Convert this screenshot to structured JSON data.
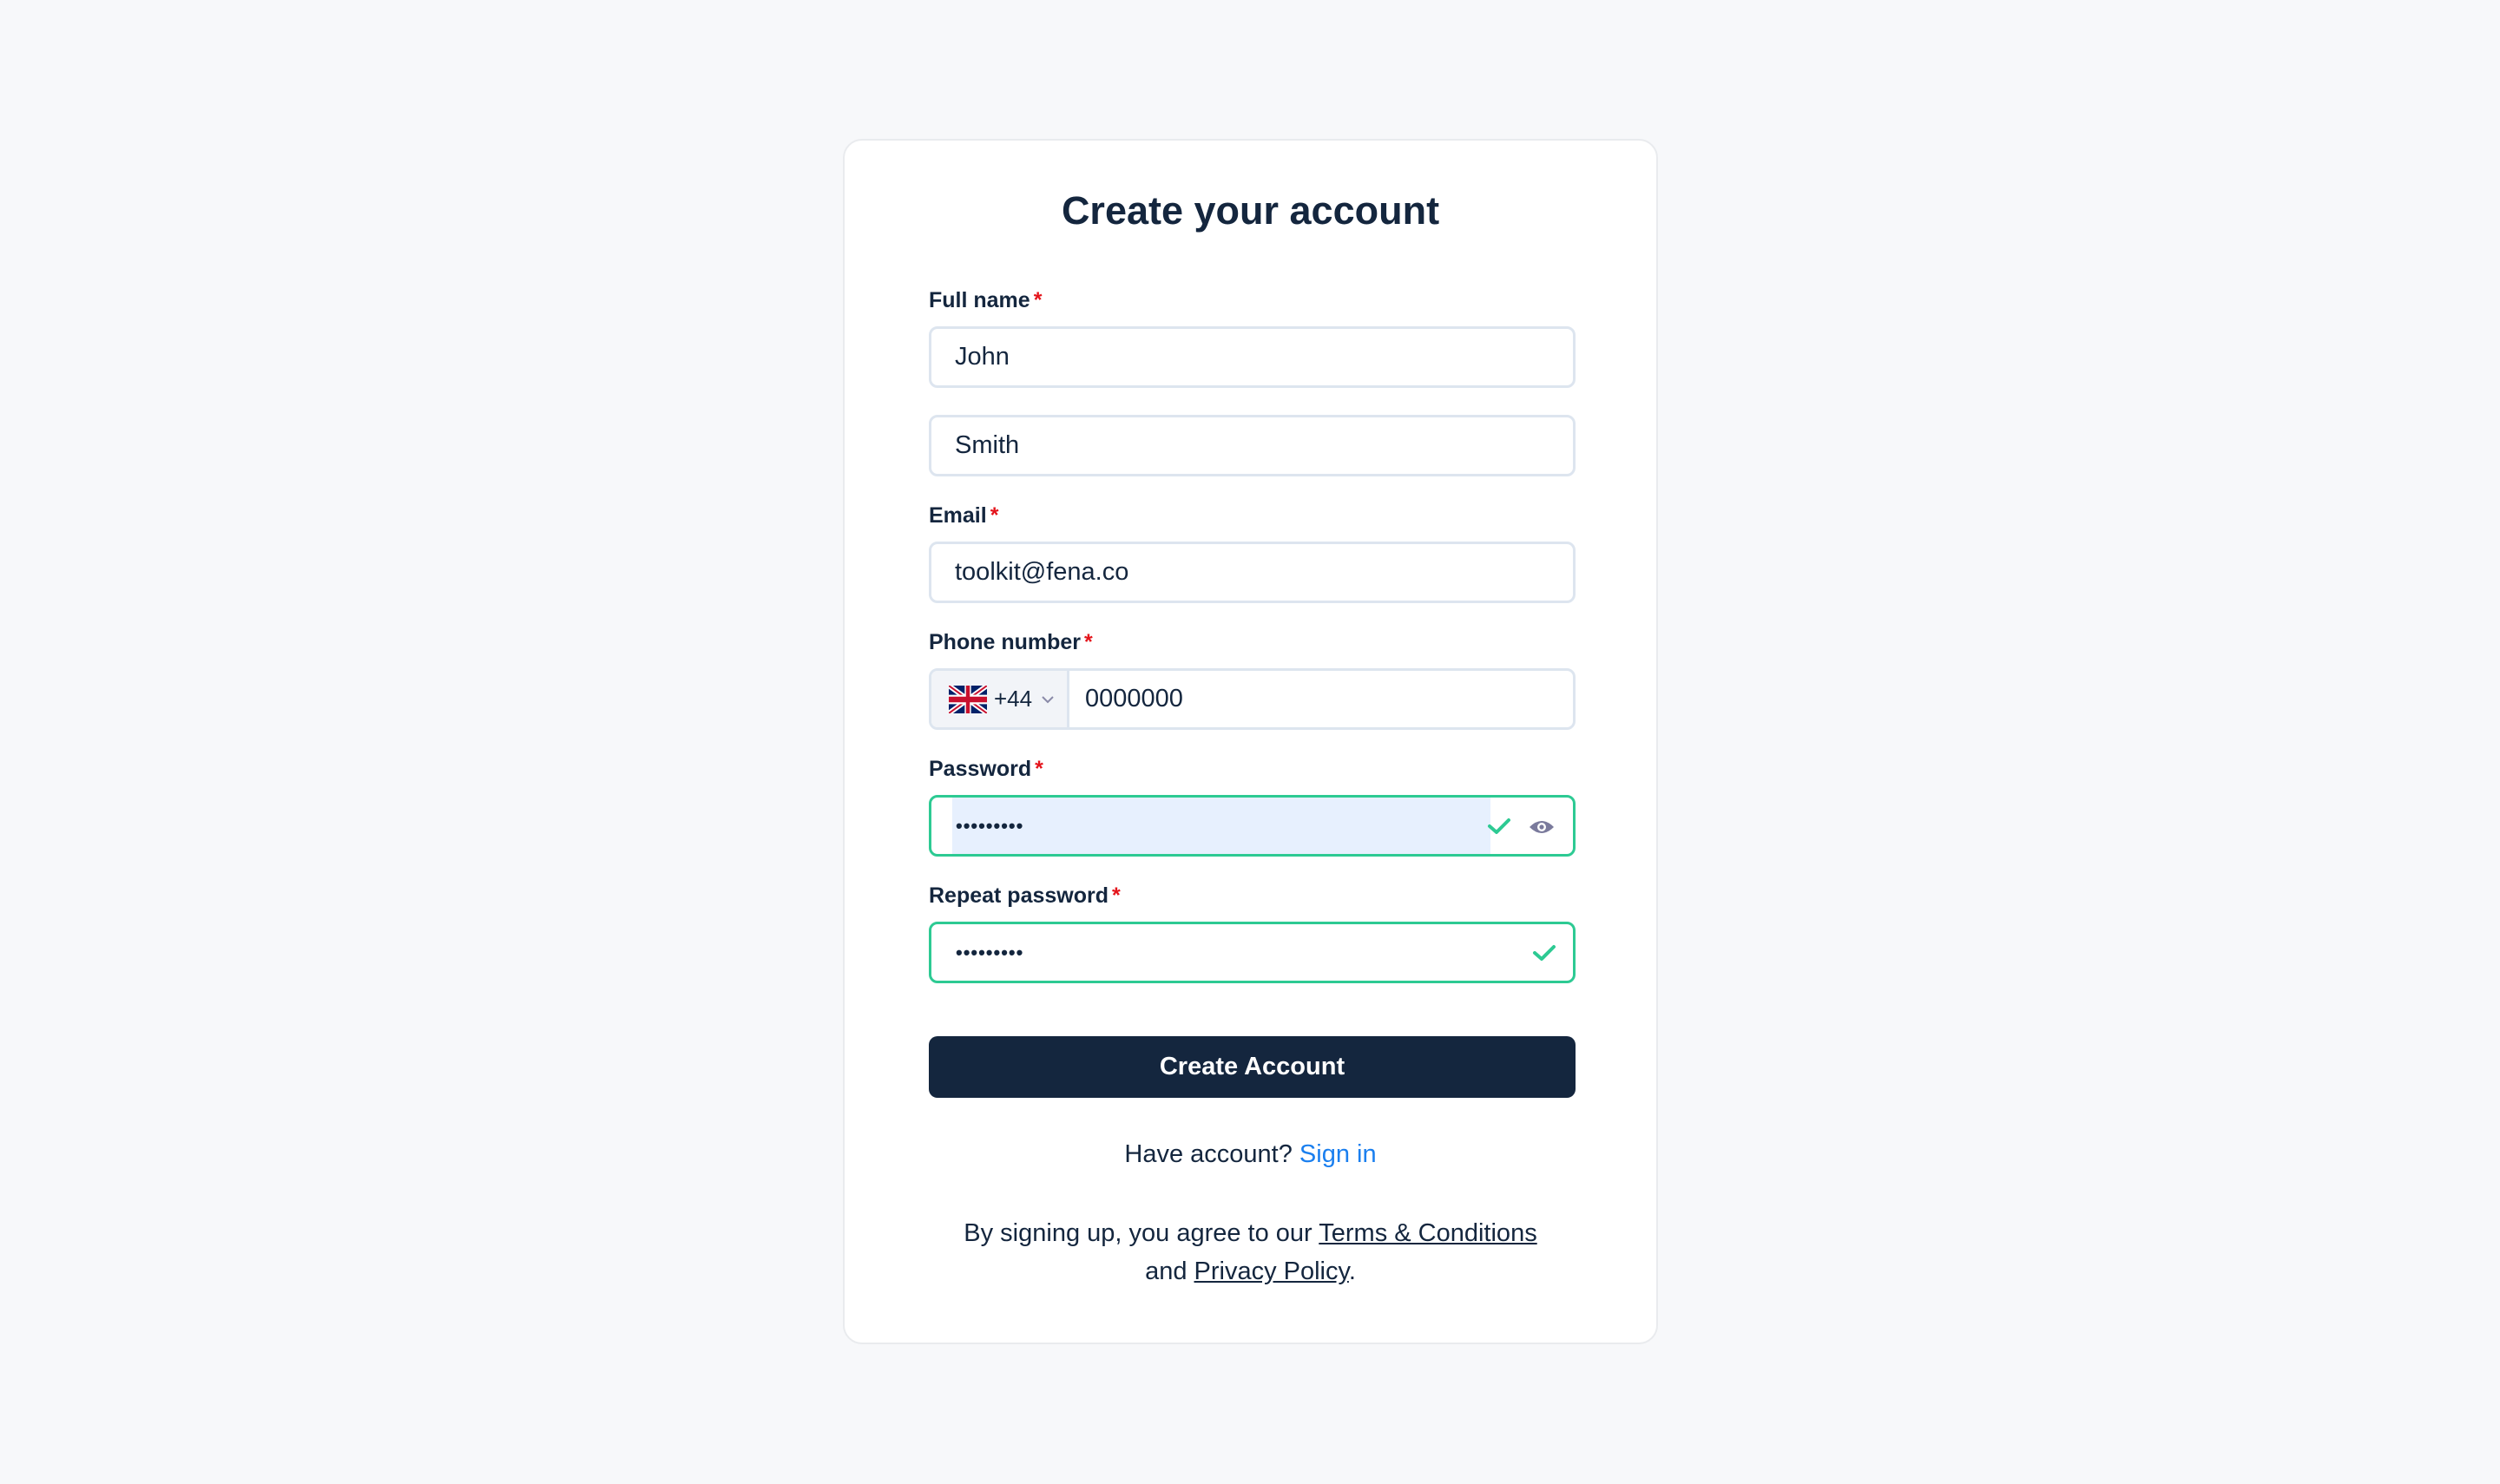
{
  "page": {
    "title": "Create your account"
  },
  "form": {
    "full_name": {
      "label": "Full name",
      "required_mark": "*",
      "first_value": "John",
      "last_value": "Smith"
    },
    "email": {
      "label": "Email",
      "required_mark": "*",
      "value": "toolkit@fena.co"
    },
    "phone": {
      "label": "Phone number",
      "required_mark": "*",
      "country_flag": "uk-flag-icon",
      "country_code": "+44",
      "value": "0000000"
    },
    "password": {
      "label": "Password",
      "required_mark": "*",
      "masked_value": "•••••••••",
      "status": "valid",
      "toggle_icon": "eye-icon"
    },
    "repeat_password": {
      "label": "Repeat password",
      "required_mark": "*",
      "masked_value": "•••••••••",
      "status": "valid"
    },
    "submit_label": "Create Account"
  },
  "footer": {
    "have_account_text": "Have account?",
    "sign_in_label": "Sign in",
    "terms_prefix": "By signing up, you agree to our",
    "terms_link": "Terms & Conditions",
    "and_text": "and",
    "privacy_link": "Privacy Policy",
    "period": "."
  },
  "colors": {
    "primary": "#14263e",
    "valid": "#2dca93",
    "link": "#1a7fef",
    "required": "#e4141b"
  }
}
